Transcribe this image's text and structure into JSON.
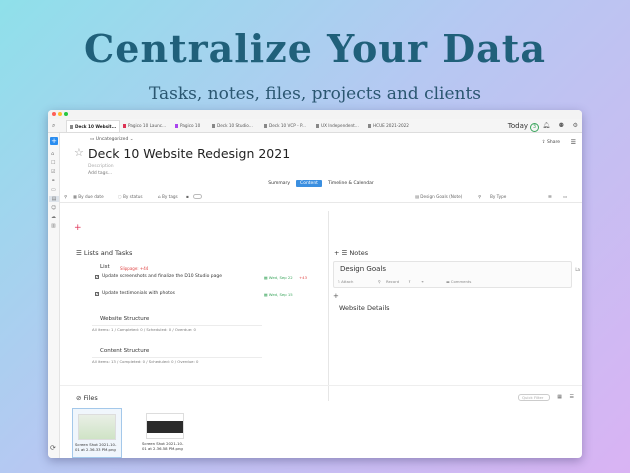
{
  "hero": {
    "title": "Centralize Your Data",
    "subtitle": "Tasks, notes, files, projects and clients"
  },
  "colors": {
    "accent": "#2a8df0",
    "hero_title": "#20607a",
    "slippage": "#e04545",
    "due_green": "#3aa55c"
  },
  "tabs": [
    {
      "label": "Deck 10 Websit...",
      "active": true
    },
    {
      "label": "Pagico 10 Launc...",
      "active": false
    },
    {
      "label": "Pagico 10",
      "active": false
    },
    {
      "label": "Deck 10 Studio...",
      "active": false
    },
    {
      "label": "Deck 10 VCP - P...",
      "active": false
    },
    {
      "label": "UX Independent...",
      "active": false
    },
    {
      "label": "HCUE 2021-2022",
      "active": false
    }
  ],
  "toolbar": {
    "today_label": "Today",
    "today_count": "3"
  },
  "project": {
    "category": "Uncategorized",
    "title": "Deck 10 Website Redesign 2021",
    "description_placeholder": "Description",
    "add_tags": "Add tags...",
    "share_label": "Share"
  },
  "views": [
    "Summary",
    "Content",
    "Timeline & Calendar"
  ],
  "filters": {
    "by_due_date": "By due date",
    "by_status": "By status",
    "by_tags": "By tags",
    "design_goals": "Design Goals (Note)",
    "by_type": "By Type"
  },
  "lists": {
    "heading": "Lists and Tasks",
    "list_name": "List",
    "slippage": "Slippage: +44",
    "tasks": [
      {
        "text": "Update screenshots and finalize the D10 Studio page",
        "date": "Wed, Sep 22",
        "slip": "+43"
      },
      {
        "text": "Update testimonials with photos",
        "date": "Wed, Sep 15",
        "slip": ""
      }
    ],
    "groups": [
      {
        "title": "Website Structure",
        "stats": "All items: 1 / Completed: 0 / Scheduled: 0 / Overdue: 0"
      },
      {
        "title": "Content Structure",
        "stats": "All items: 13 / Completed: 0 / Scheduled: 0 / Overdue: 0"
      }
    ]
  },
  "notes": {
    "heading": "Notes",
    "card_title": "Design Goals",
    "attach": "Attach",
    "record": "Record",
    "comments": "Comments",
    "second_title": "Website Details",
    "side_label": "La"
  },
  "files": {
    "heading": "Files",
    "search_placeholder": "Quick Filter",
    "items": [
      {
        "name": "Screen Shot 2021-10-01 at 2.36.33 PM.png"
      },
      {
        "name": "Screen Shot 2021-10-01 at 2.36.58 PM.png"
      }
    ]
  }
}
